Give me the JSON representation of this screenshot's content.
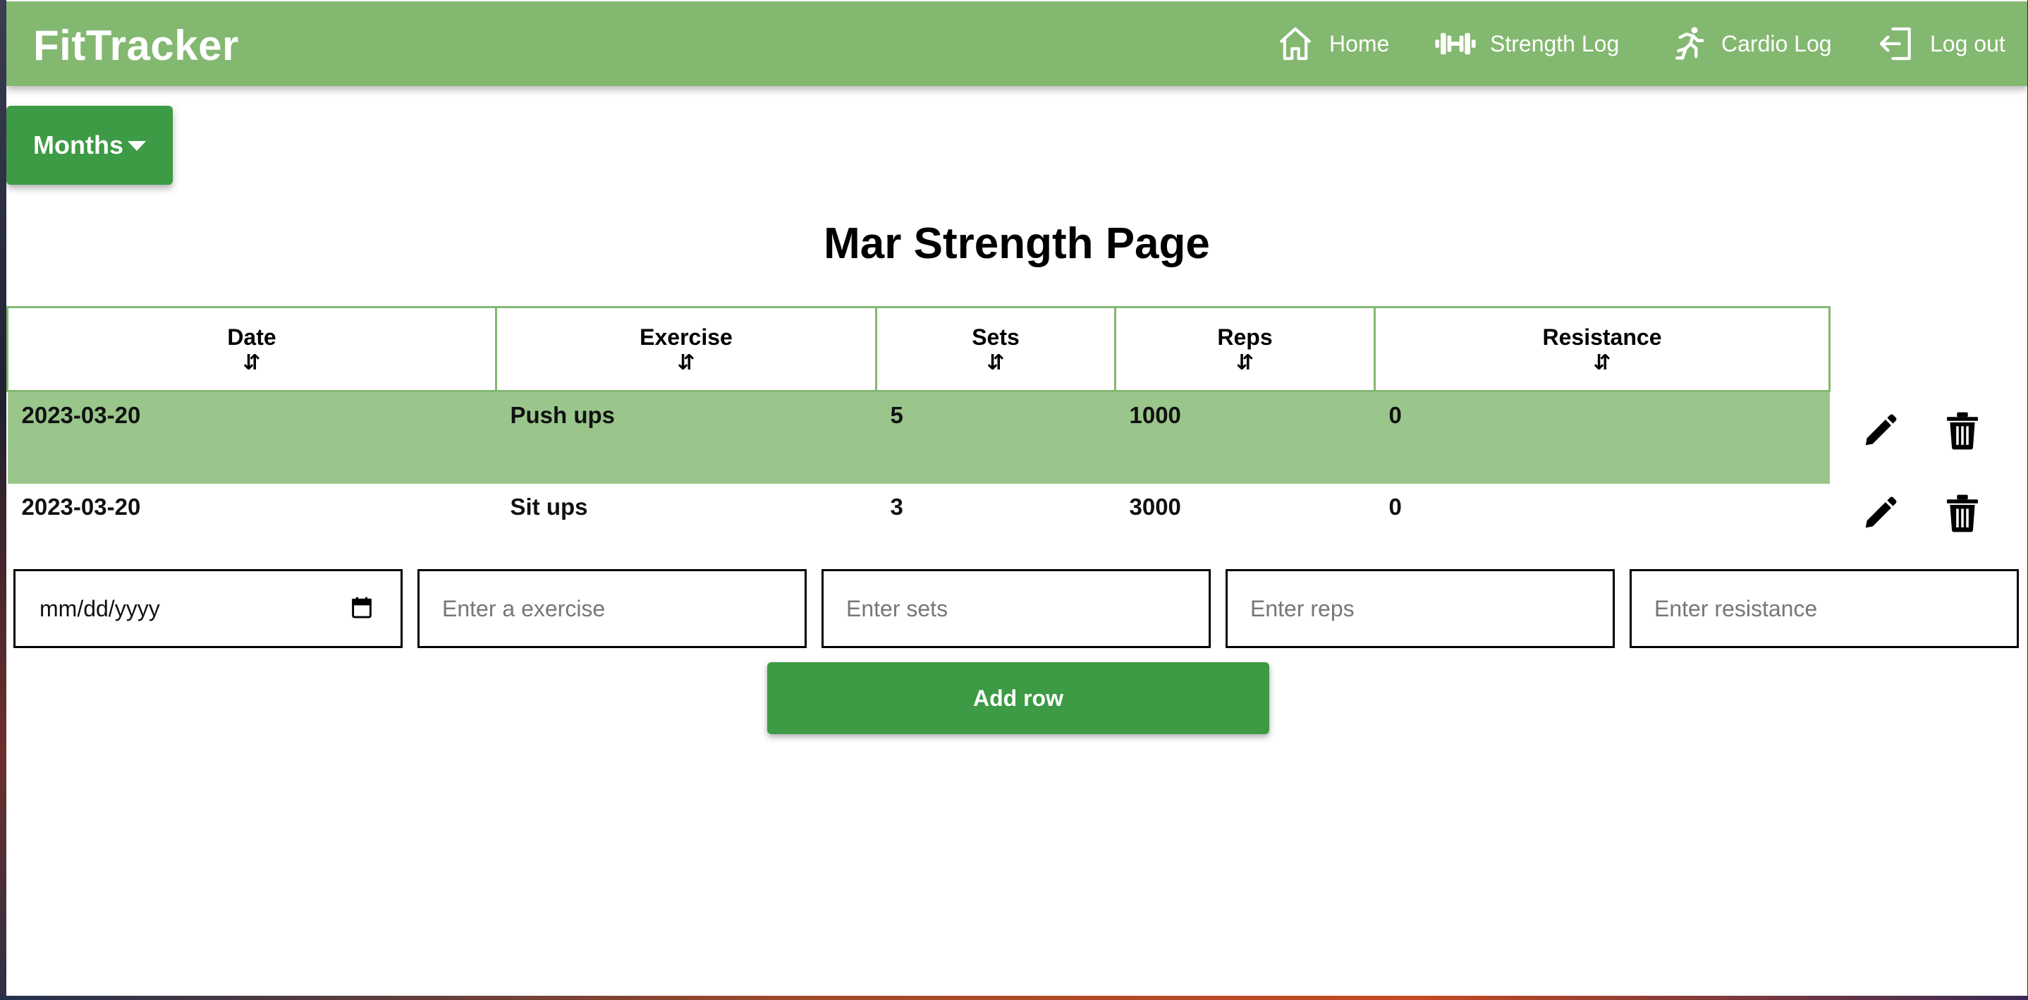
{
  "app": {
    "brand": "FitTracker"
  },
  "nav": {
    "home": "Home",
    "strength": "Strength Log",
    "cardio": "Cardio Log",
    "logout": "Log out"
  },
  "months_button": {
    "label": "Months"
  },
  "page": {
    "title": "Mar Strength Page"
  },
  "table": {
    "headers": [
      "Date",
      "Exercise",
      "Sets",
      "Reps",
      "Resistance"
    ],
    "sort_glyph": "⇵",
    "rows": [
      {
        "date": "2023-03-20",
        "exercise": "Push ups",
        "sets": "5",
        "reps": "1000",
        "resistance": "0",
        "highlighted": true
      },
      {
        "date": "2023-03-20",
        "exercise": "Sit ups",
        "sets": "3",
        "reps": "3000",
        "resistance": "0",
        "highlighted": false
      }
    ]
  },
  "form": {
    "date_placeholder": "mm/dd/yyyy",
    "exercise_placeholder": "Enter a exercise",
    "sets_placeholder": "Enter sets",
    "reps_placeholder": "Enter reps",
    "resistance_placeholder": "Enter resistance",
    "add_button": "Add row"
  },
  "colors": {
    "navbar": "#83b870",
    "button": "#3d9a45",
    "row_highlight": "#9ac68b",
    "table_border": "#83b870"
  },
  "icons": {
    "home": "home-icon",
    "strength": "dumbbell-icon",
    "cardio": "running-icon",
    "logout": "logout-icon",
    "edit": "pencil-icon",
    "delete": "trash-icon",
    "calendar": "calendar-icon",
    "caret": "caret-down-icon"
  }
}
